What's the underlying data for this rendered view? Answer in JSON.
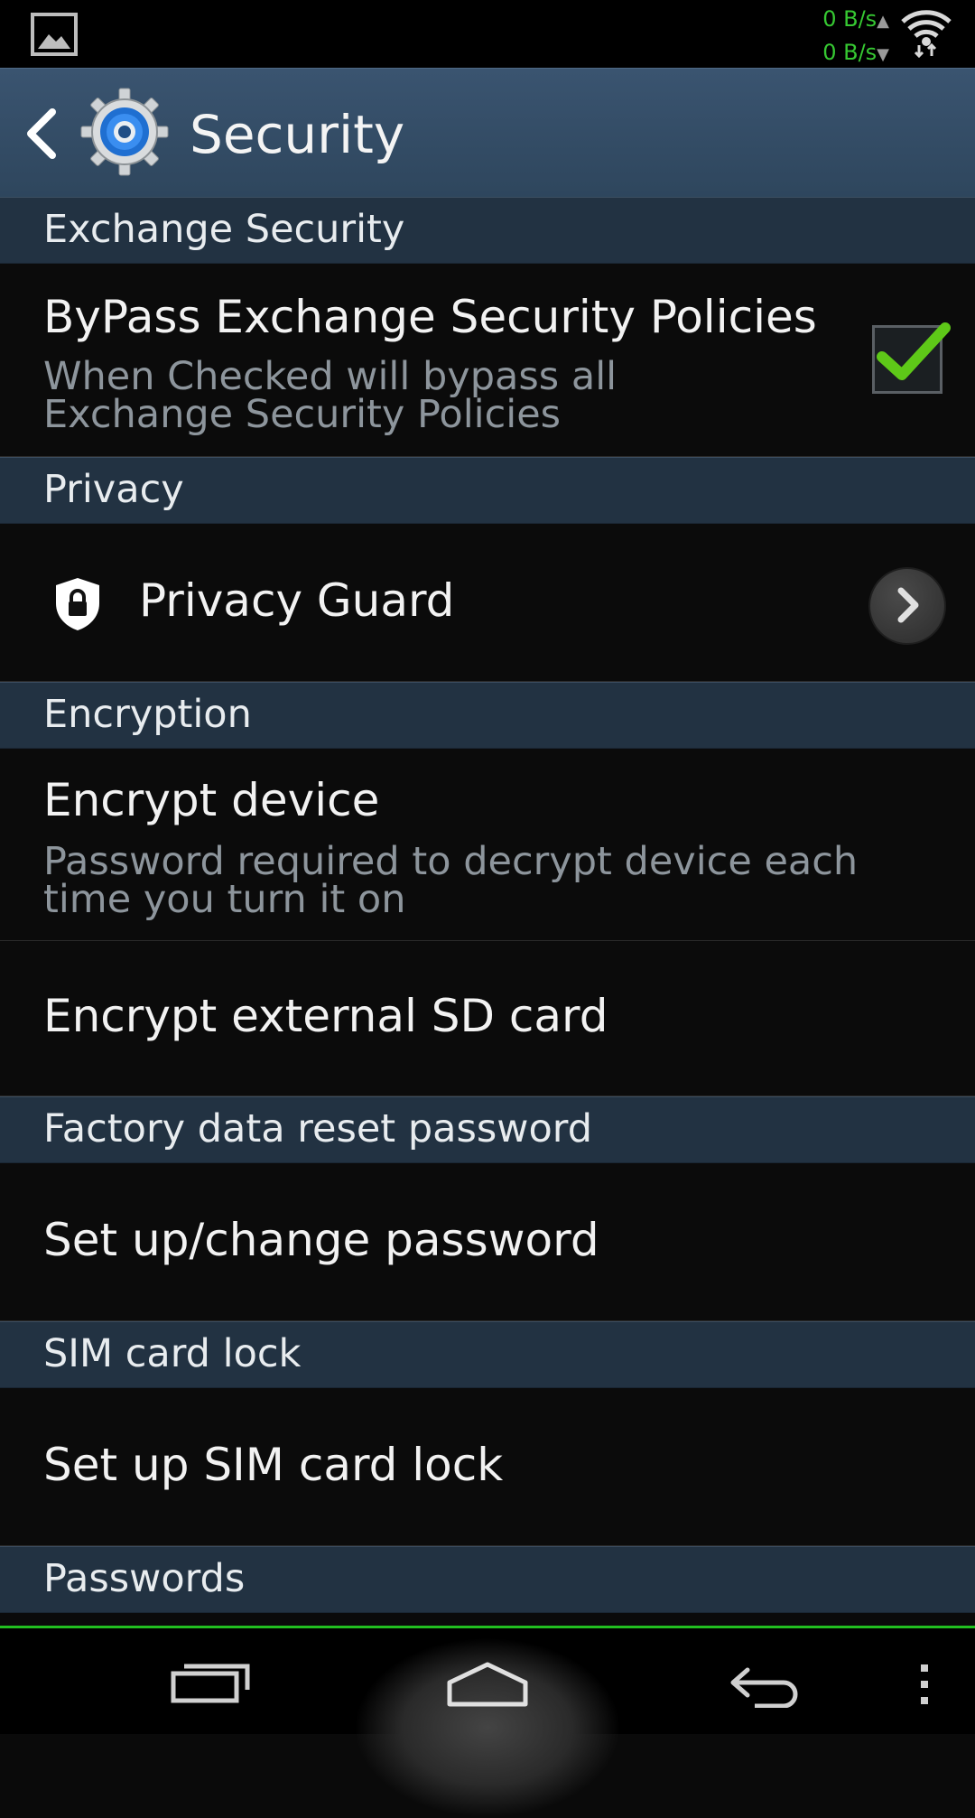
{
  "status_bar": {
    "upload_speed": "0 B/s",
    "download_speed": "0 B/s",
    "icons": [
      "gallery-icon",
      "wifi-icon"
    ],
    "accent_color": "#36c832"
  },
  "action_bar": {
    "title": "Security",
    "icons": [
      "back-icon",
      "settings-gear-icon"
    ],
    "background": "#34506a"
  },
  "sections": {
    "exchange": {
      "header": "Exchange Security",
      "bypass_title": "ByPass Exchange Security Policies",
      "bypass_summary": "When Checked will bypass all Exchange Security Policies",
      "bypass_checked": true
    },
    "privacy": {
      "header": "Privacy",
      "privacy_guard": "Privacy Guard"
    },
    "encryption": {
      "header": "Encryption",
      "encrypt_device_title": "Encrypt device",
      "encrypt_device_summary": "Password required to decrypt device each time you turn it on",
      "encrypt_sd": "Encrypt external SD card"
    },
    "factory_reset": {
      "header": "Factory data reset password",
      "setup_password": "Set up/change password"
    },
    "sim": {
      "header": "SIM card lock",
      "setup_sim": "Set up SIM card lock"
    },
    "passwords": {
      "header": "Passwords"
    }
  },
  "nav_bar": {
    "icons": [
      "recent-apps-icon",
      "home-icon",
      "back-icon",
      "menu-icon"
    ],
    "accent_color": "#22c020"
  }
}
